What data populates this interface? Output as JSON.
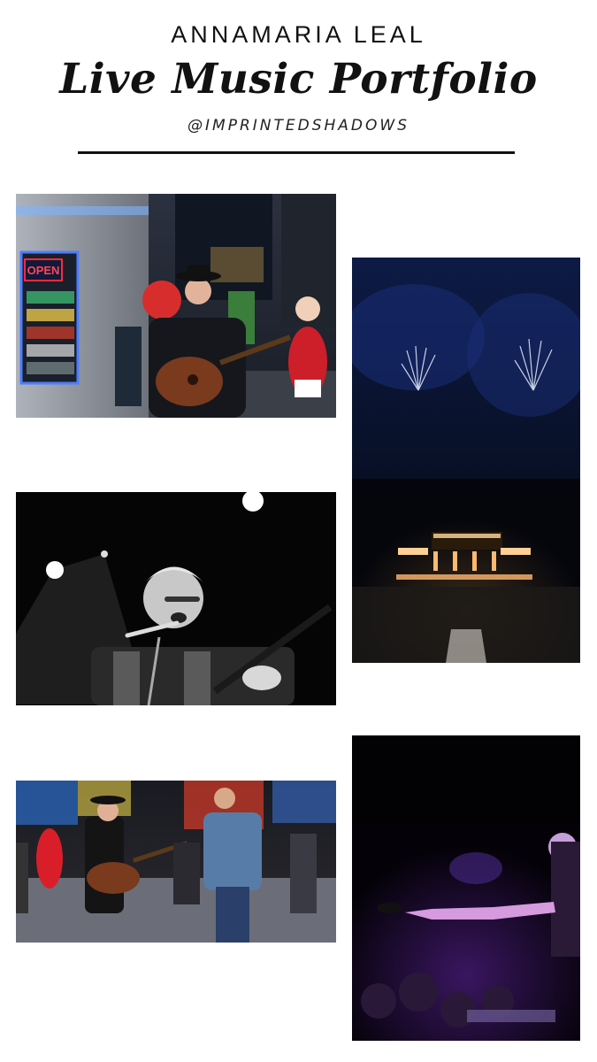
{
  "header": {
    "author": "ANNAMARIA LEAL",
    "title": "Live Music Portfolio",
    "handle": "@IMPRINTEDSHADOWS"
  },
  "photos": {
    "times_square_busker": {
      "sign_text": "OPEN",
      "kind": "color"
    },
    "fireworks_concert": {
      "kind": "color"
    },
    "bw_singer": {
      "kind": "black-and-white"
    },
    "street_duo": {
      "kind": "color"
    },
    "purple_stage": {
      "kind": "color"
    }
  }
}
